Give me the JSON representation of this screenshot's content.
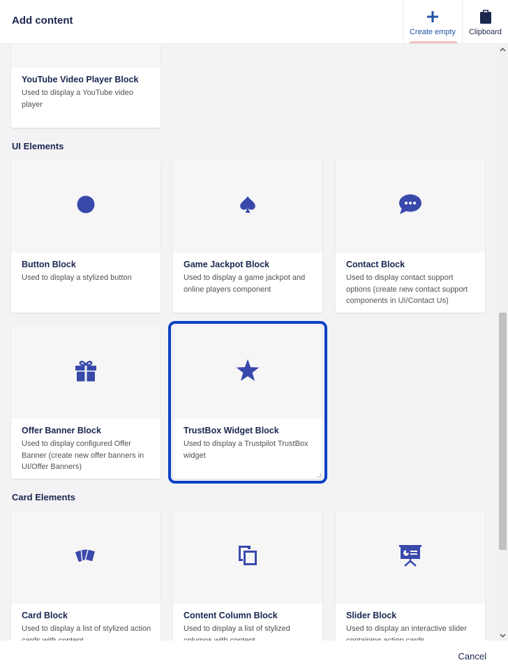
{
  "header": {
    "title": "Add content",
    "create_empty_label": "Create empty",
    "clipboard_label": "Clipboard"
  },
  "sections": {
    "partial_card": {
      "name": "YouTube Video Player Block",
      "description": "Used to display a YouTube video player"
    },
    "ui_elements": {
      "title": "UI Elements",
      "cards": [
        {
          "name": "Button Block",
          "description": "Used to display a stylized button",
          "icon": "circle-icon"
        },
        {
          "name": "Game Jackpot Block",
          "description": "Used to display a game jackpot and online players component",
          "icon": "spade-icon"
        },
        {
          "name": "Contact Block",
          "description": "Used to display contact support options (create new contact support components in UI/Contact Us)",
          "icon": "chat-bubble-icon"
        },
        {
          "name": "Offer Banner Block",
          "description": "Used to display configured Offer Banner (create new offer banners in UI/Offer Banners)",
          "icon": "gift-icon"
        },
        {
          "name": "TrustBox Widget Block",
          "description": "Used to display a Trustpilot TrustBox widget",
          "icon": "star-icon"
        }
      ]
    },
    "card_elements": {
      "title": "Card Elements",
      "cards": [
        {
          "name": "Card Block",
          "description": "Used to display a list of stylized action cards with content",
          "icon": "cards-icon"
        },
        {
          "name": "Content Column Block",
          "description": "Used to display a list of stylized columns with content",
          "icon": "copy-icon"
        },
        {
          "name": "Slider Block",
          "description": "Used to display an interactive slider containing action cards",
          "icon": "presentation-icon"
        }
      ]
    }
  },
  "footer": {
    "cancel_label": "Cancel"
  },
  "colors": {
    "accent": "#0a41c4",
    "icon": "#3949ab",
    "title_text": "#1b264f",
    "background": "#f3f3f5"
  }
}
